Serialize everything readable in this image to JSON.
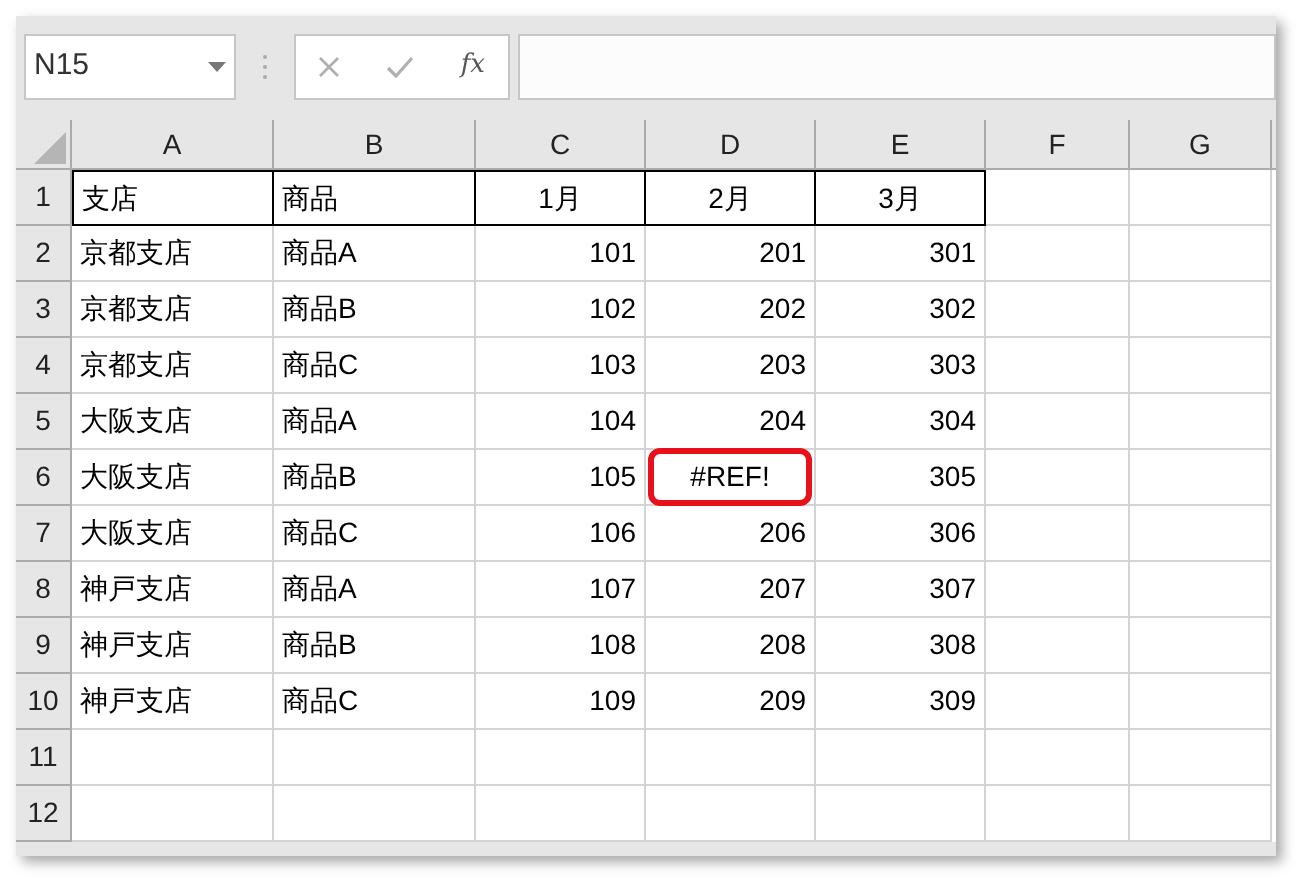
{
  "name_box": {
    "value": "N15"
  },
  "formula_bar": {
    "function_label": "fx"
  },
  "columns": [
    "A",
    "B",
    "C",
    "D",
    "E",
    "F",
    "G"
  ],
  "rows": [
    {
      "number": "1",
      "kind": "header",
      "cells": [
        {
          "text": "支店",
          "kind": "text"
        },
        {
          "text": "商品",
          "kind": "text"
        },
        {
          "text": "1月",
          "kind": "label"
        },
        {
          "text": "2月",
          "kind": "label"
        },
        {
          "text": "3月",
          "kind": "label"
        }
      ]
    },
    {
      "number": "2",
      "kind": "data",
      "cells": [
        {
          "text": "京都支店",
          "kind": "text"
        },
        {
          "text": "商品A",
          "kind": "text"
        },
        {
          "text": "101",
          "kind": "number"
        },
        {
          "text": "201",
          "kind": "number"
        },
        {
          "text": "301",
          "kind": "number"
        }
      ]
    },
    {
      "number": "3",
      "kind": "data",
      "cells": [
        {
          "text": "京都支店",
          "kind": "text"
        },
        {
          "text": "商品B",
          "kind": "text"
        },
        {
          "text": "102",
          "kind": "number"
        },
        {
          "text": "202",
          "kind": "number"
        },
        {
          "text": "302",
          "kind": "number"
        }
      ]
    },
    {
      "number": "4",
      "kind": "data",
      "cells": [
        {
          "text": "京都支店",
          "kind": "text"
        },
        {
          "text": "商品C",
          "kind": "text"
        },
        {
          "text": "103",
          "kind": "number"
        },
        {
          "text": "203",
          "kind": "number"
        },
        {
          "text": "303",
          "kind": "number"
        }
      ]
    },
    {
      "number": "5",
      "kind": "data",
      "cells": [
        {
          "text": "大阪支店",
          "kind": "text"
        },
        {
          "text": "商品A",
          "kind": "text"
        },
        {
          "text": "104",
          "kind": "number"
        },
        {
          "text": "204",
          "kind": "number"
        },
        {
          "text": "304",
          "kind": "number"
        }
      ]
    },
    {
      "number": "6",
      "kind": "data",
      "cells": [
        {
          "text": "大阪支店",
          "kind": "text"
        },
        {
          "text": "商品B",
          "kind": "text"
        },
        {
          "text": "105",
          "kind": "number"
        },
        {
          "text": "#REF!",
          "kind": "error"
        },
        {
          "text": "305",
          "kind": "number"
        }
      ]
    },
    {
      "number": "7",
      "kind": "data",
      "cells": [
        {
          "text": "大阪支店",
          "kind": "text"
        },
        {
          "text": "商品C",
          "kind": "text"
        },
        {
          "text": "106",
          "kind": "number"
        },
        {
          "text": "206",
          "kind": "number"
        },
        {
          "text": "306",
          "kind": "number"
        }
      ]
    },
    {
      "number": "8",
      "kind": "data",
      "cells": [
        {
          "text": "神戸支店",
          "kind": "text"
        },
        {
          "text": "商品A",
          "kind": "text"
        },
        {
          "text": "107",
          "kind": "number"
        },
        {
          "text": "207",
          "kind": "number"
        },
        {
          "text": "307",
          "kind": "number"
        }
      ]
    },
    {
      "number": "9",
      "kind": "data",
      "cells": [
        {
          "text": "神戸支店",
          "kind": "text"
        },
        {
          "text": "商品B",
          "kind": "text"
        },
        {
          "text": "108",
          "kind": "number"
        },
        {
          "text": "208",
          "kind": "number"
        },
        {
          "text": "308",
          "kind": "number"
        }
      ]
    },
    {
      "number": "10",
      "kind": "data",
      "cells": [
        {
          "text": "神戸支店",
          "kind": "text"
        },
        {
          "text": "商品C",
          "kind": "text"
        },
        {
          "text": "109",
          "kind": "number"
        },
        {
          "text": "209",
          "kind": "number"
        },
        {
          "text": "309",
          "kind": "number"
        }
      ]
    },
    {
      "number": "11",
      "kind": "data",
      "cells": []
    },
    {
      "number": "12",
      "kind": "data",
      "cells": []
    }
  ]
}
